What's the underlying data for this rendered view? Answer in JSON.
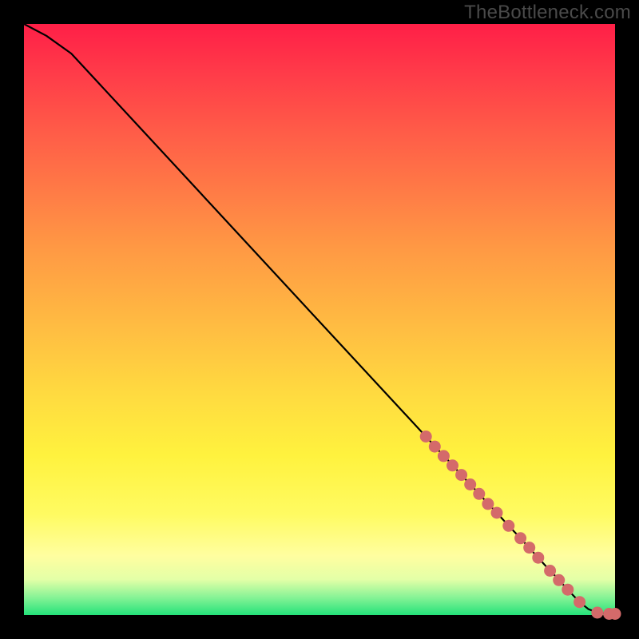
{
  "watermark": "TheBottleneck.com",
  "colors": {
    "background": "#000000",
    "gradient_top": "#ff1f47",
    "gradient_bottom": "#24e27a",
    "line": "#000000",
    "marker": "#d46a6a"
  },
  "chart_data": {
    "type": "line",
    "title": "",
    "xlabel": "",
    "ylabel": "",
    "xlim": [
      0,
      100
    ],
    "ylim": [
      0,
      100
    ],
    "series": [
      {
        "name": "bottleneck-curve",
        "x": [
          0,
          3.8,
          8,
          18,
          28,
          38,
          48,
          58,
          68,
          70,
          72,
          74,
          76,
          78,
          80,
          82,
          84,
          86,
          88,
          89,
          90,
          92,
          94,
          95.5,
          97,
          99,
          100
        ],
        "y": [
          100,
          98,
          95,
          84.2,
          73.4,
          62.6,
          51.8,
          41,
          30.2,
          28,
          25.9,
          23.7,
          21.6,
          19.4,
          17.3,
          15.1,
          13,
          10.8,
          8.6,
          7.5,
          6.5,
          4.3,
          2.2,
          1.0,
          0.4,
          0.2,
          0.2
        ]
      }
    ],
    "markers": {
      "name": "highlighted-points",
      "x": [
        68,
        69.5,
        71,
        72.5,
        74,
        75.5,
        77,
        78.5,
        80,
        82,
        84,
        85.5,
        87,
        89,
        90.5,
        92,
        94,
        97,
        99,
        100
      ],
      "y": [
        30.2,
        28.5,
        26.9,
        25.3,
        23.7,
        22.1,
        20.5,
        18.8,
        17.3,
        15.1,
        13.0,
        11.4,
        9.7,
        7.5,
        5.9,
        4.3,
        2.2,
        0.4,
        0.2,
        0.2
      ]
    }
  }
}
